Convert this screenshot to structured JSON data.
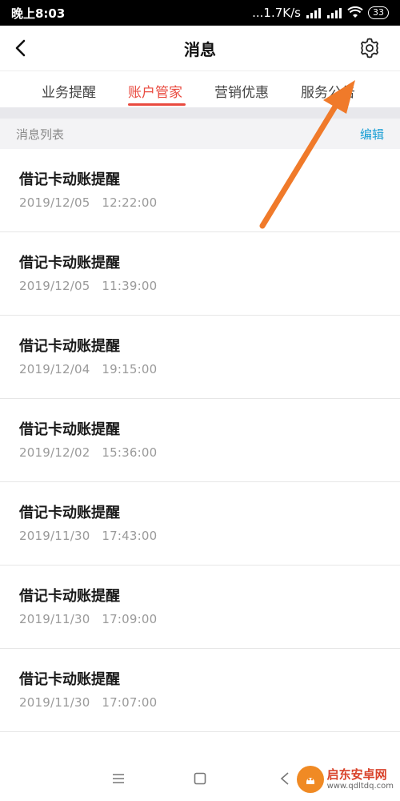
{
  "status_bar": {
    "time": "晚上8:03",
    "network_speed": "...1.7K/s",
    "battery": "33"
  },
  "header": {
    "title": "消息"
  },
  "tabs": [
    {
      "label": "业务提醒",
      "active": false
    },
    {
      "label": "账户管家",
      "active": true
    },
    {
      "label": "营销优惠",
      "active": false
    },
    {
      "label": "服务公告",
      "active": false
    }
  ],
  "list_header": {
    "title": "消息列表",
    "edit_label": "编辑"
  },
  "messages": [
    {
      "title": "借记卡动账提醒",
      "time": "2019/12/05   12:22:00"
    },
    {
      "title": "借记卡动账提醒",
      "time": "2019/12/05   11:39:00"
    },
    {
      "title": "借记卡动账提醒",
      "time": "2019/12/04   19:15:00"
    },
    {
      "title": "借记卡动账提醒",
      "time": "2019/12/02   15:36:00"
    },
    {
      "title": "借记卡动账提醒",
      "time": "2019/11/30   17:43:00"
    },
    {
      "title": "借记卡动账提醒",
      "time": "2019/11/30   17:09:00"
    },
    {
      "title": "借记卡动账提醒",
      "time": "2019/11/30   17:07:00"
    }
  ],
  "watermark": {
    "name": "启东安卓网",
    "url": "www.qdltdq.com"
  },
  "colors": {
    "accent": "#e94a3f",
    "edit_link": "#1a9fd5",
    "annotation_arrow": "#f07a2a"
  },
  "icons": {
    "back": "chevron-left-icon",
    "settings": "gear-icon",
    "nav_menu": "menu-icon",
    "nav_home": "square-home-icon",
    "nav_back": "triangle-back-icon"
  }
}
